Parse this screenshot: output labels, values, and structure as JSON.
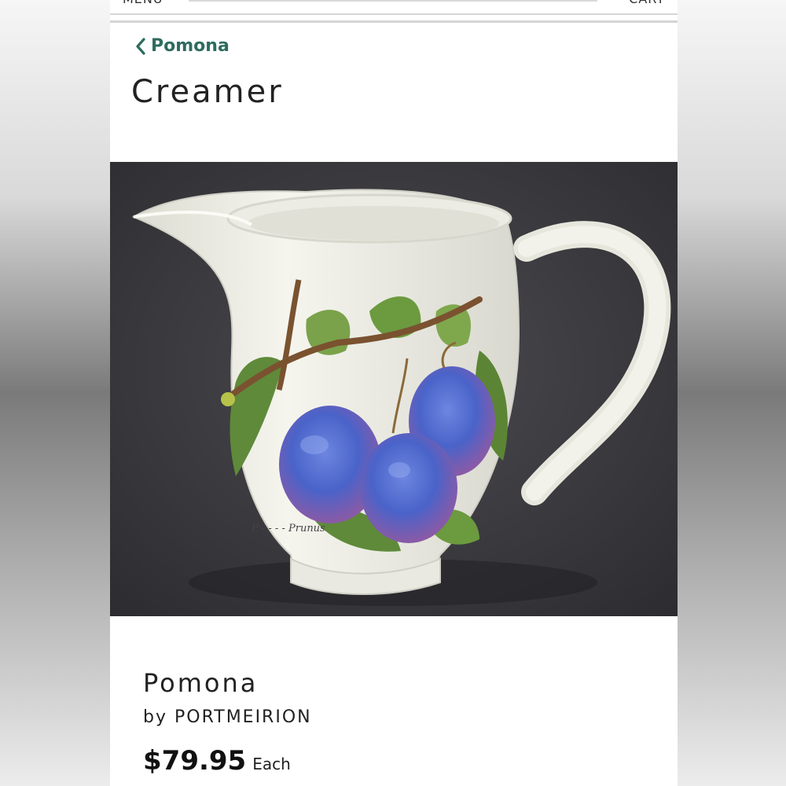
{
  "header": {
    "menu_label": "MENU",
    "cart_label": "CART"
  },
  "breadcrumb": {
    "label": "Pomona"
  },
  "page_title": "Creamer",
  "product": {
    "name": "Pomona",
    "by_prefix": "by",
    "brand": "PORTMEIRION",
    "price": "$79.95",
    "unit": "Each",
    "image_alt": "Pomona creamer with plums design"
  },
  "colors": {
    "accent": "#2e6b5e",
    "text": "#222222",
    "photo_bg": "#3a3a3e"
  },
  "icons": {
    "back": "chevron-left-icon"
  }
}
